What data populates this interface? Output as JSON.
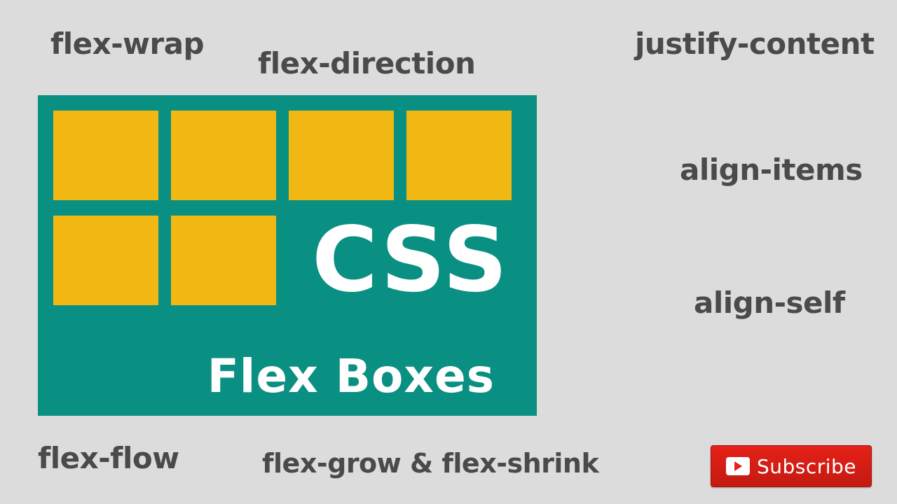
{
  "labels": {
    "flex_wrap": "flex-wrap",
    "flex_direction": "flex-direction",
    "justify_content": "justify-content",
    "align_items": "align-items",
    "align_self": "align-self",
    "flex_flow": "flex-flow",
    "flex_grow_shrink": "flex-grow & flex-shrink"
  },
  "card": {
    "title_big": "CSS",
    "title_sub": "Flex Boxes"
  },
  "subscribe": {
    "label": "Subscribe"
  },
  "colors": {
    "background": "#dcdcdc",
    "card_bg": "#0a9083",
    "box_yellow": "#f1b813",
    "text_gray": "#4a4a4a",
    "subscribe_red": "#e62117"
  }
}
